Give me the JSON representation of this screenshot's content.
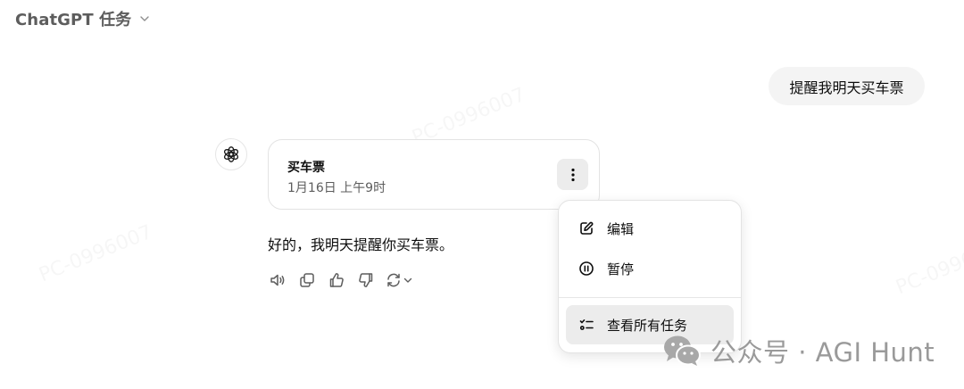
{
  "header": {
    "title": "ChatGPT 任务"
  },
  "conversation": {
    "user_message": "提醒我明天买车票",
    "task_card": {
      "title": "买车票",
      "schedule": "1月16日 上午9时"
    },
    "assistant_reply": "好的，我明天提醒你买车票。"
  },
  "context_menu": {
    "edit_label": "编辑",
    "pause_label": "暂停",
    "view_all_label": "查看所有任务"
  },
  "watermark": {
    "id_text": "PC-0996007",
    "brand": "公众号 · AGI Hunt"
  },
  "colors": {
    "menu_highlight": "#ececec",
    "user_bubble": "#f4f4f4",
    "muted_text": "#5d5d5d"
  }
}
